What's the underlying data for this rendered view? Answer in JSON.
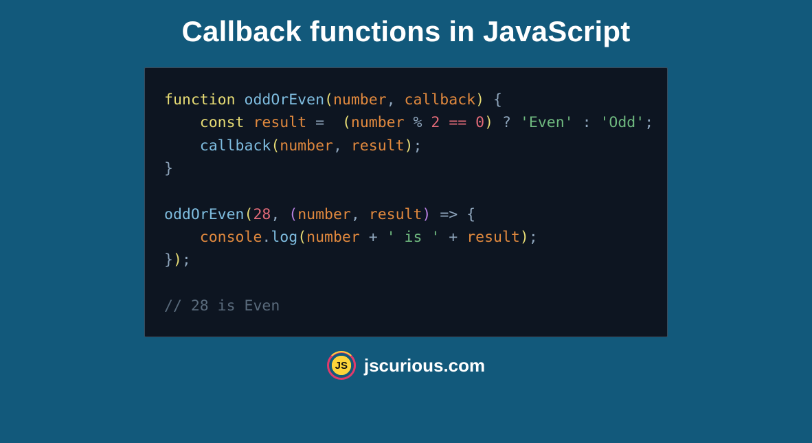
{
  "title": "Callback functions in JavaScript",
  "code": {
    "l1": {
      "function": "function",
      "space": " ",
      "name": "oddOrEven",
      "lp": "(",
      "p1": "number",
      "c1": ", ",
      "p2": "callback",
      "rp": ")",
      "sp": " ",
      "lb": "{"
    },
    "l2": {
      "indent": "    ",
      "const": "const",
      "sp1": " ",
      "var": "result",
      "sp2": " ",
      "eq": "=",
      "sp3": "  ",
      "lp": "(",
      "p1": "number",
      "sp4": " ",
      "mod": "%",
      "sp5": " ",
      "two": "2",
      "sp6": " ",
      "deq": "==",
      "sp7": " ",
      "zero": "0",
      "rp": ")",
      "sp8": " ",
      "q": "?",
      "sp9": " ",
      "even": "'Even'",
      "sp10": " ",
      "colon": ":",
      "sp11": " ",
      "odd": "'Odd'",
      "semi": ";"
    },
    "l3": {
      "indent": "    ",
      "call": "callback",
      "lp": "(",
      "p1": "number",
      "c1": ", ",
      "p2": "result",
      "rp": ")",
      "semi": ";"
    },
    "l4": {
      "rb": "}"
    },
    "l6": {
      "call": "oddOrEven",
      "lp": "(",
      "n": "28",
      "c1": ", ",
      "lp2": "(",
      "p1": "number",
      "c2": ", ",
      "p2": "result",
      "rp2": ")",
      "sp": " ",
      "arrow": "=>",
      "sp2": " ",
      "lb": "{"
    },
    "l7": {
      "indent": "    ",
      "console": "console",
      "dot": ".",
      "log": "log",
      "lp": "(",
      "p1": "number",
      "sp1": " ",
      "plus1": "+",
      "sp2": " ",
      "str": "' is '",
      "sp3": " ",
      "plus2": "+",
      "sp4": " ",
      "p2": "result",
      "rp": ")",
      "semi": ";"
    },
    "l8": {
      "rb": "}",
      "rp": ")",
      "semi": ";"
    },
    "comment": "// 28 is Even"
  },
  "footer": {
    "logo_text": "JS",
    "site": "jscurious.com"
  }
}
